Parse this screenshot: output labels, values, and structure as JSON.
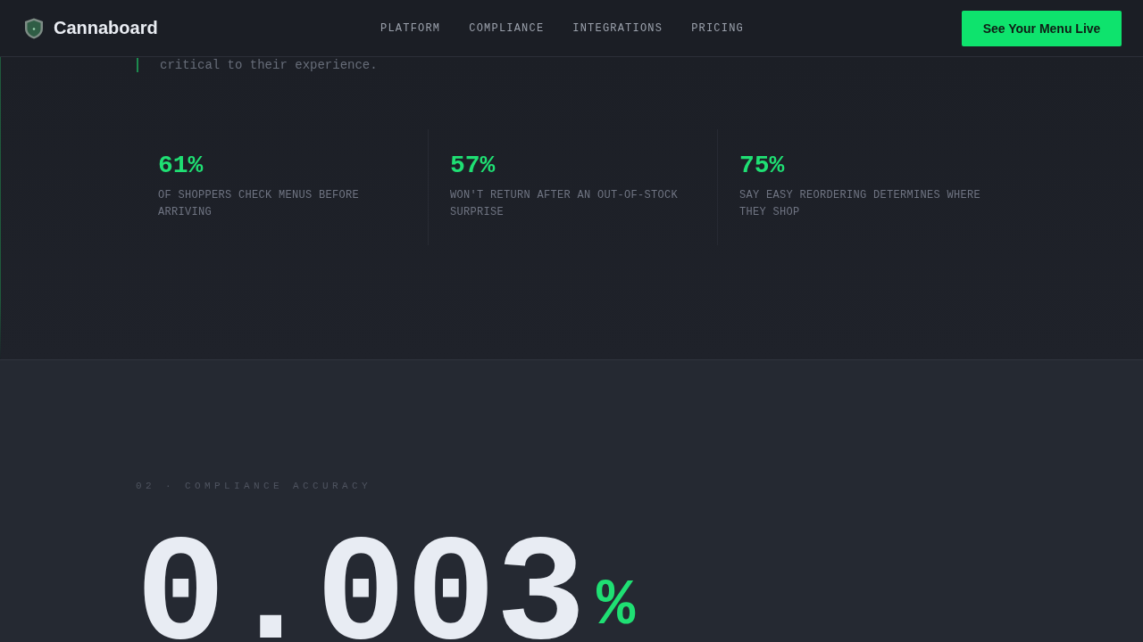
{
  "header": {
    "brand": "Cannaboard",
    "nav": [
      "PLATFORM",
      "COMPLIANCE",
      "INTEGRATIONS",
      "PRICING"
    ],
    "cta": "See Your Menu Live"
  },
  "quote": {
    "text": "critical to their experience."
  },
  "stats": [
    {
      "value": "61%",
      "label": "OF SHOPPERS CHECK MENUS BEFORE ARRIVING"
    },
    {
      "value": "57%",
      "label": "WON'T RETURN AFTER AN OUT-OF-STOCK SURPRISE"
    },
    {
      "value": "75%",
      "label": "SAY EASY REORDERING DETERMINES WHERE THEY SHOP"
    }
  ],
  "compliance": {
    "eyebrow": "02 · COMPLIANCE ACCURACY",
    "value": "0.003",
    "unit": "%"
  }
}
